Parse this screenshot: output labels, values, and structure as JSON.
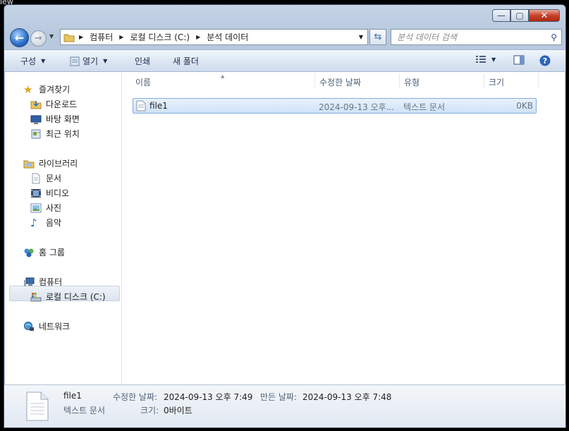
{
  "window": {
    "min_glyph": "—",
    "max_glyph": "▢",
    "close_glyph": "✕"
  },
  "address": {
    "crumbs": [
      "컴퓨터",
      "로컬 디스크 (C:)",
      "분석 데이터"
    ]
  },
  "search": {
    "placeholder": "분석 데이터 검색"
  },
  "toolbar": {
    "organize": "구성",
    "open": "열기",
    "print": "인쇄",
    "new_folder": "새 폴더"
  },
  "sidebar": {
    "favorites": "즐겨찾기",
    "downloads": "다운로드",
    "desktop": "바탕 화면",
    "recent": "최근 위치",
    "libraries": "라이브러리",
    "documents": "문서",
    "videos": "비디오",
    "pictures": "사진",
    "music": "음악",
    "homegroup": "홈 그룹",
    "computer": "컴퓨터",
    "local_disk": "로컬 디스크 (C:)",
    "network": "네트워크"
  },
  "columns": {
    "name": "이름",
    "modified": "수정한 날짜",
    "type": "유형",
    "size": "크기"
  },
  "files": [
    {
      "name": "file1",
      "modified": "2024-09-13 오후...",
      "type": "텍스트 문서",
      "size": "0KB"
    }
  ],
  "details": {
    "name": "file1",
    "type": "텍스트 문서",
    "modified_label": "수정한 날짜:",
    "modified_value": "2024-09-13 오후 7:49",
    "created_label": "만든 날짜:",
    "created_value": "2024-09-13 오후 7:48",
    "size_label": "크기:",
    "size_value": "0바이트"
  }
}
